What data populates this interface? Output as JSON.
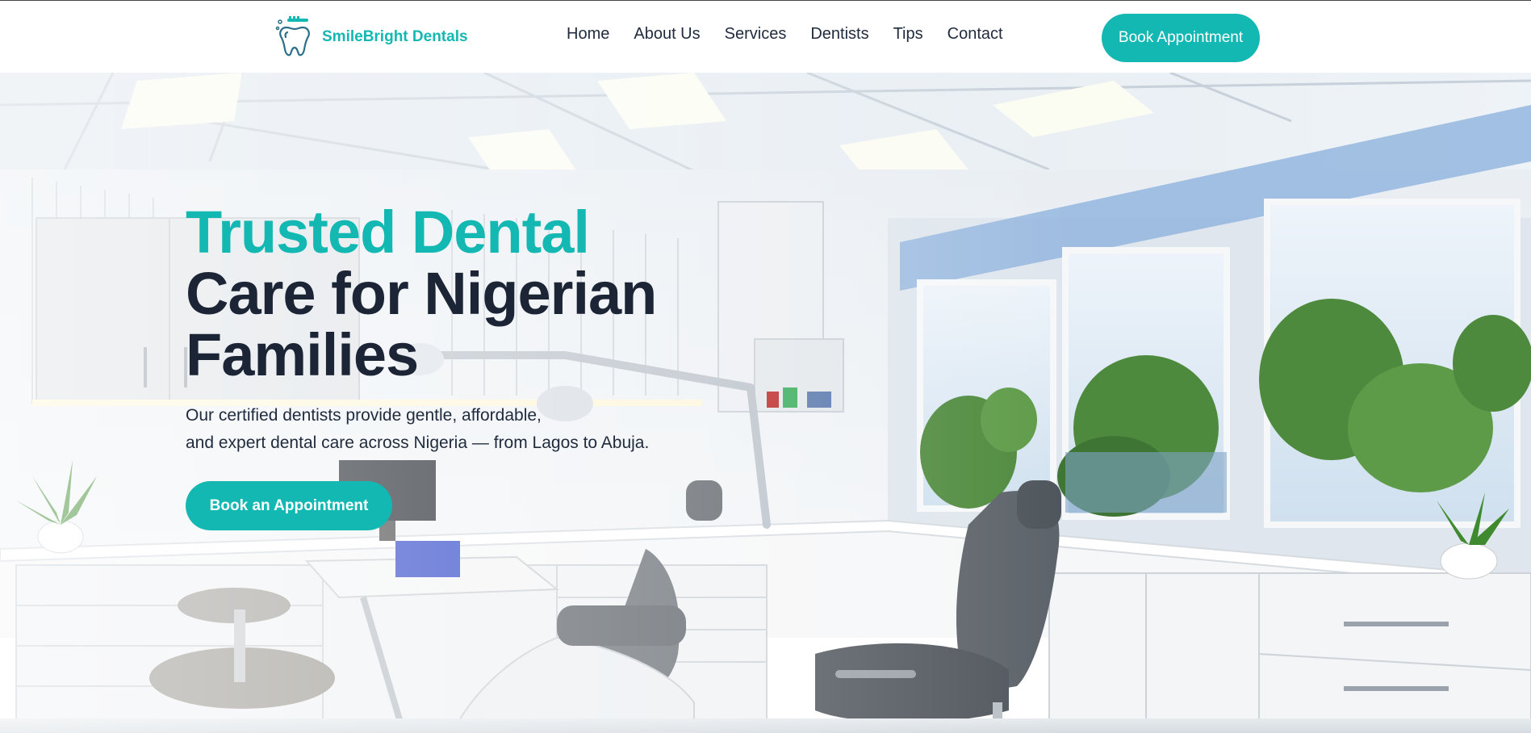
{
  "brand": {
    "name": "SmileBright Dentals",
    "logo_icon": "tooth-toothbrush-icon"
  },
  "nav": {
    "items": [
      {
        "label": "Home"
      },
      {
        "label": "About Us"
      },
      {
        "label": "Services"
      },
      {
        "label": "Dentists"
      },
      {
        "label": "Tips"
      },
      {
        "label": "Contact"
      }
    ],
    "cta_label": "Book Appointment"
  },
  "hero": {
    "title_line1": "Trusted Dental",
    "title_line2": "Care for Nigerian",
    "title_line3": "Families",
    "subtitle_line1": "Our certified dentists provide gentle, affordable,",
    "subtitle_line2": "and expert dental care across Nigeria — from Lagos to Abuja.",
    "cta_label": "Book an Appointment",
    "background_image": "modern-dental-clinic-room"
  },
  "colors": {
    "accent": "#14b8b3",
    "heading_dark": "#1c2536",
    "text": "#1f2b3d"
  }
}
